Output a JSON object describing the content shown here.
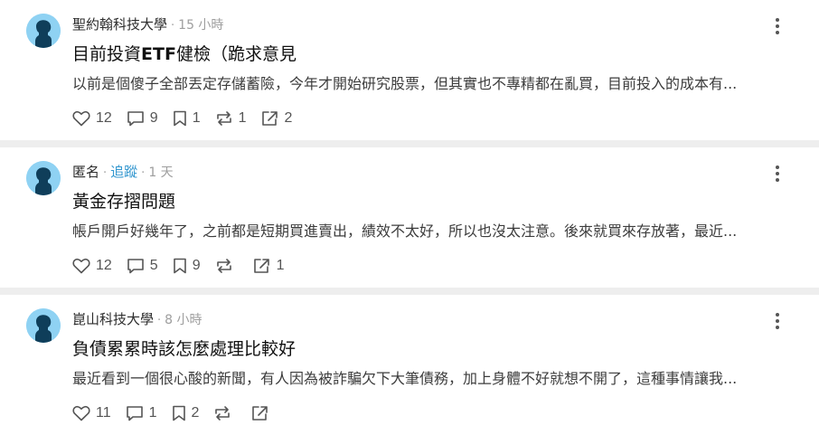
{
  "posts": [
    {
      "author": "聖約翰科技大學",
      "follow": "",
      "time": "15 小時",
      "title_prefix": "目前投資",
      "title_bold": "ETF",
      "title_suffix": "健檢（跪求意見",
      "excerpt": "以前是個傻子全部丟定存儲蓄險，今年才開始研究股票，但其實也不專精都在亂買，目前投入的成本有...",
      "likes": "12",
      "comments": "9",
      "saves": "1",
      "reposts": "1",
      "shares": "2"
    },
    {
      "author": "匿名",
      "follow": "追蹤",
      "time": "1 天",
      "title_prefix": "黃金存摺問題",
      "title_bold": "",
      "title_suffix": "",
      "excerpt": "帳戶開戶好幾年了，之前都是短期買進賣出，績效不太好，所以也沒太注意。後來就買來存放著，最近...",
      "likes": "12",
      "comments": "5",
      "saves": "9",
      "reposts": "",
      "shares": "1"
    },
    {
      "author": "崑山科技大學",
      "follow": "",
      "time": "8 小時",
      "title_prefix": "負債累累時該怎麼處理比較好",
      "title_bold": "",
      "title_suffix": "",
      "excerpt": "最近看到一個很心酸的新聞，有人因為被詐騙欠下大筆債務，加上身體不好就想不開了，這種事情讓我...",
      "likes": "11",
      "comments": "1",
      "saves": "2",
      "reposts": "",
      "shares": ""
    }
  ],
  "colors": {
    "avatar": "#8fd2f3",
    "follow": "#3397cf",
    "separator": "#eeeeee"
  }
}
